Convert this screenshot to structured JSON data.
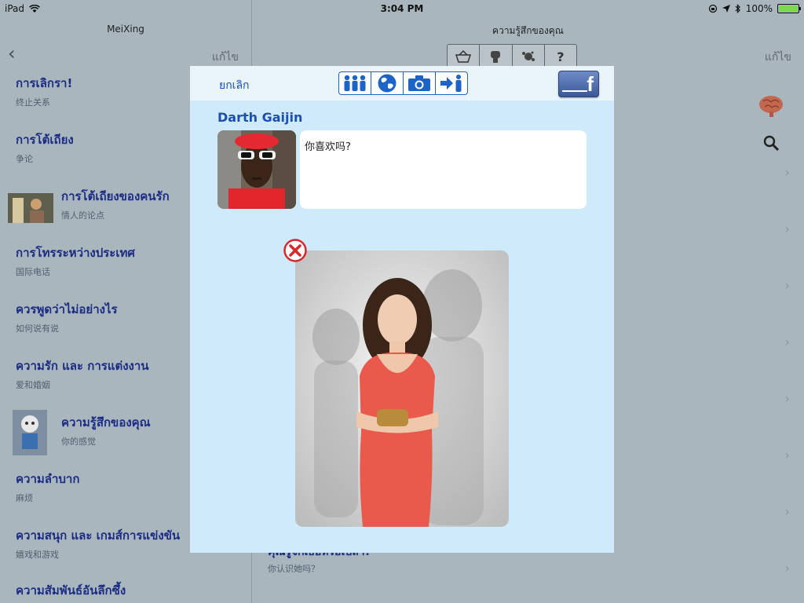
{
  "status_bar": {
    "device": "iPad",
    "time": "3:04 PM",
    "battery": "100%"
  },
  "left_pane": {
    "title": "MeiXing",
    "edit_label": "แก้ไข",
    "items": [
      {
        "th": "การเลิกรา!",
        "zh": "终止关系"
      },
      {
        "th": "การโต้เถียง",
        "zh": "争论"
      },
      {
        "th": "การโต้เถียงของคนรัก",
        "zh": "情人的论点"
      },
      {
        "th": "การโทรระหว่างประเทศ",
        "zh": "国际电话"
      },
      {
        "th": "ควรพูดว่าไม่อย่างไร",
        "zh": "如何说有说"
      },
      {
        "th": "ความรัก และ การแต่งงาน",
        "zh": "爱和婚姻"
      },
      {
        "th": "ความรู้สึกของคุณ",
        "zh": "你的感觉"
      },
      {
        "th": "ความลำบาก",
        "zh": "麻烦"
      },
      {
        "th": "ความสนุก และ เกมส์การแข่งขัน",
        "zh": "嬉戏和游戏"
      },
      {
        "th": "ความสัมพันธ์อันลึกซึ้ง",
        "zh": ""
      }
    ]
  },
  "right_pane": {
    "title": "ความรู้สึกของคุณ",
    "edit_label": "แก้ไข",
    "segments": [
      "basket-icon",
      "fist-icon",
      "splat-icon",
      "?"
    ],
    "partial_row": {
      "th": "คุณรู้จักเธอหรือเปล่า?",
      "zh": "你认识她吗？"
    }
  },
  "modal": {
    "cancel_label": "ยกเลิก",
    "tools": [
      "people-icon",
      "globe-icon",
      "camera-icon",
      "arrow-person-icon"
    ],
    "facebook_label": "f",
    "username": "Darth Gaijin",
    "message": "你喜欢吗?"
  },
  "colors": {
    "accent": "#1c4fb4",
    "modal_bg": "#cfeafb",
    "facebook": "#3b5998",
    "remove": "#d9262a"
  }
}
